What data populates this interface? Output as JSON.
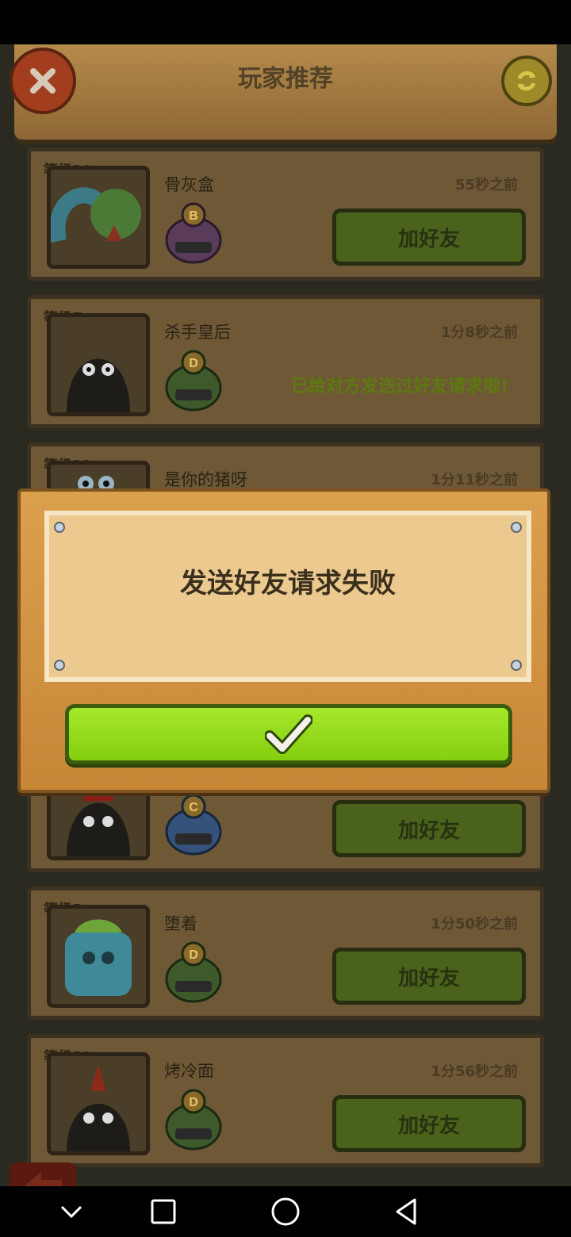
{
  "header": {
    "title": "玩家推荐"
  },
  "cards": [
    {
      "level": "等级29",
      "name": "骨灰盒",
      "time": "55秒之前",
      "badge": "B",
      "action": "加好友"
    },
    {
      "level": "等级7",
      "name": "杀手皇后",
      "time": "1分8秒之前",
      "badge": "D",
      "action": "已给对方发送过好友请求啦!"
    },
    {
      "level": "等级11",
      "name": "是你的猪呀",
      "time": "1分11秒之前",
      "badge": "",
      "action": ""
    },
    {
      "level": "",
      "name": "",
      "time": "",
      "badge": "C",
      "action": "加好友"
    },
    {
      "level": "等级5",
      "name": "堕着",
      "time": "1分50秒之前",
      "badge": "D",
      "action": "加好友"
    },
    {
      "level": "等级51",
      "name": "烤冷面",
      "time": "1分56秒之前",
      "badge": "D",
      "action": "加好友"
    }
  ],
  "dialog": {
    "message": "发送好友请求失败",
    "confirm_icon": "checkmark-icon"
  },
  "nav": {
    "icons": [
      "chevron-down-icon",
      "square-icon",
      "circle-icon",
      "triangle-back-icon"
    ]
  },
  "colors": {
    "add_button": "#4b621c",
    "confirm_button": "#94dc18",
    "board": "#d19444",
    "paper": "#ecca8f"
  }
}
